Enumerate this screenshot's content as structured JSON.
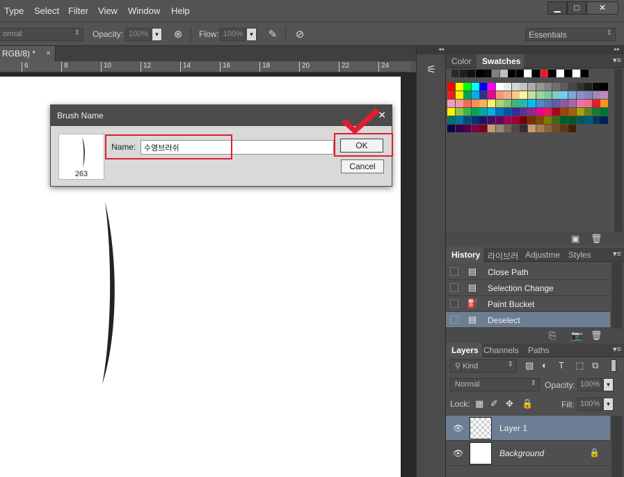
{
  "menu": [
    "Type",
    "Select",
    "Filter",
    "View",
    "Window",
    "Help"
  ],
  "window_buttons": {
    "minimize": "▁",
    "maximize": "□",
    "close": "✕"
  },
  "options": {
    "mode": "ormal",
    "opacity_label": "Opacity:",
    "opacity_value": "100%",
    "flow_label": "Flow:",
    "flow_value": "100%",
    "workspace": "Essentials"
  },
  "document": {
    "tab_title": "RGB/8) *",
    "tab_close": "×",
    "ruler_ticks": [
      "6",
      "8",
      "10",
      "12",
      "14",
      "16",
      "18",
      "20",
      "22",
      "24"
    ]
  },
  "dialog": {
    "title": "Brush Name",
    "close": "✕",
    "preview_size": "263",
    "name_label": "Name:",
    "name_value": "수영브러쉬",
    "ok_label": "OK",
    "cancel_label": "Cancel"
  },
  "swatch_panel": {
    "tabs": [
      "Color",
      "Swatches"
    ],
    "active_tab": "Swatches",
    "palette": [
      [
        "#ff0000",
        "#ffff00",
        "#00ff00",
        "#00ffff",
        "#0000ff",
        "#ff00ff",
        "#ffffff",
        "#ebebeb",
        "#d6d6d6",
        "#c2c2c2",
        "#adadad",
        "#999999",
        "#858585",
        "#707070",
        "#5c5c5c",
        "#474747",
        "#333333",
        "#1f1f1f",
        "#0a0a0a",
        "#000000"
      ],
      [
        "#ee1d24",
        "#fff200",
        "#00a651",
        "#00aeef",
        "#2e3192",
        "#ec008c",
        "#f7977a",
        "#fbad82",
        "#fdc68c",
        "#fff79a",
        "#c4df9b",
        "#a3d39c",
        "#82ca9c",
        "#7accc8",
        "#6dcff6",
        "#7da7d9",
        "#8493ca",
        "#8882be",
        "#a187be",
        "#bc8cbf"
      ],
      [
        "#f49ac2",
        "#f6989d",
        "#f26c4f",
        "#f68e56",
        "#fbaf5d",
        "#fff467",
        "#acd372",
        "#7dc473",
        "#3cb878",
        "#1cbbb4",
        "#00bff3",
        "#448ccb",
        "#5574b9",
        "#605ca8",
        "#855fa8",
        "#a864a8",
        "#f06ea9",
        "#f26d7d",
        "#ed1c24",
        "#f7941d"
      ],
      [
        "#fff200",
        "#8dc63f",
        "#39b54a",
        "#00a651",
        "#00a99d",
        "#00aeef",
        "#0072bc",
        "#0054a6",
        "#2e3192",
        "#662d91",
        "#92278f",
        "#ec008c",
        "#ed145b",
        "#9e0b0f",
        "#a0410d",
        "#a36209",
        "#aba000",
        "#598527",
        "#1a7b30",
        "#007236"
      ],
      [
        "#00746b",
        "#0076a3",
        "#004a80",
        "#003471",
        "#1b1464",
        "#440e62",
        "#630460",
        "#9e005d",
        "#9e0039",
        "#790000",
        "#7b2e00",
        "#7d4900",
        "#827b00",
        "#406618",
        "#005e20",
        "#005826",
        "#005952",
        "#005b7f",
        "#003663",
        "#002157"
      ],
      [
        "#0d004c",
        "#32004b",
        "#4b0049",
        "#7b0046",
        "#7a0026",
        "#c69c6d",
        "#998675",
        "#736357",
        "#534741",
        "#362f2d",
        "#c69c6d",
        "#a67c52",
        "#8c6239",
        "#754c24",
        "#603913",
        "#42210b"
      ]
    ]
  },
  "history_panel": {
    "tabs": [
      "History",
      "라이브러",
      "Adjustme",
      "Styles"
    ],
    "active_tab": "History",
    "items": [
      {
        "label": "Close Path",
        "icon": "document-icon"
      },
      {
        "label": "Selection Change",
        "icon": "document-icon"
      },
      {
        "label": "Paint Bucket",
        "icon": "paint-bucket-icon"
      },
      {
        "label": "Deselect",
        "icon": "document-icon",
        "selected": true
      }
    ]
  },
  "layers_panel": {
    "tabs": [
      "Layers",
      "Channels",
      "Paths"
    ],
    "active_tab": "Layers",
    "filter_placeholder": "Kind",
    "blend_mode": "Normal",
    "opacity_label": "Opacity:",
    "opacity_value": "100%",
    "lock_label": "Lock:",
    "fill_label": "Fill:",
    "fill_value": "100%",
    "layers": [
      {
        "name": "Layer 1",
        "selected": true,
        "thumbnail": "transparent"
      },
      {
        "name": "Background",
        "selected": false,
        "thumbnail": "white",
        "locked": true
      }
    ]
  },
  "accent": {
    "annotation_red": "#e01e2d",
    "selection_blue": "#6d7d93"
  }
}
